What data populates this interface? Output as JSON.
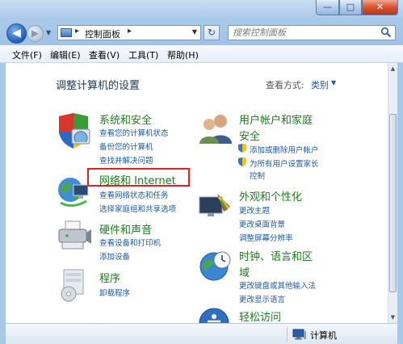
{
  "window": {
    "minimize_label": "—",
    "maximize_label": "□",
    "close_label": "✕"
  },
  "navigation": {
    "back_label": "◀",
    "forward_label": "▶",
    "breadcrumb": [
      "控制面板"
    ],
    "search_placeholder": "搜索控制面板",
    "refresh_label": "↻"
  },
  "menubar": [
    "文件(F)",
    "编辑(E)",
    "查看(V)",
    "工具(T)",
    "帮助(H)"
  ],
  "content": {
    "page_title": "调整计算机的设置",
    "view_by_label": "查看方式:",
    "view_by_value": "类别",
    "categories": [
      {
        "title": "系统和安全",
        "links": [
          "查看您的计算机状态",
          "备份您的计算机",
          "查找并解决问题"
        ]
      },
      {
        "title": "网络和 Internet",
        "links": [
          "查看网络状态和任务",
          "选择家庭组和共享选项"
        ]
      },
      {
        "title": "硬件和声音",
        "links": [
          "查看设备和打印机",
          "添加设备"
        ]
      },
      {
        "title": "程序",
        "links": [
          "卸载程序"
        ]
      },
      {
        "title_lines": [
          "用户帐户和家庭",
          "安全"
        ],
        "links": [
          "添加或删除用户帐户",
          "为所有用户设置家长",
          "控制"
        ]
      },
      {
        "title": "外观和个性化",
        "links": [
          "更改主题",
          "更改桌面背景",
          "调整屏幕分辨率"
        ]
      },
      {
        "title_lines": [
          "时钟、语言和区",
          "域"
        ],
        "links": [
          "更改键盘或其他输入法",
          "更改显示语言"
        ]
      },
      {
        "title": "轻松访问",
        "links": []
      }
    ]
  },
  "statusbar": {
    "text": "计算机"
  },
  "colors": {
    "category_title": "#1e7d1e",
    "link": "#1e5aa8",
    "highlight_box": "#e81f1f"
  }
}
